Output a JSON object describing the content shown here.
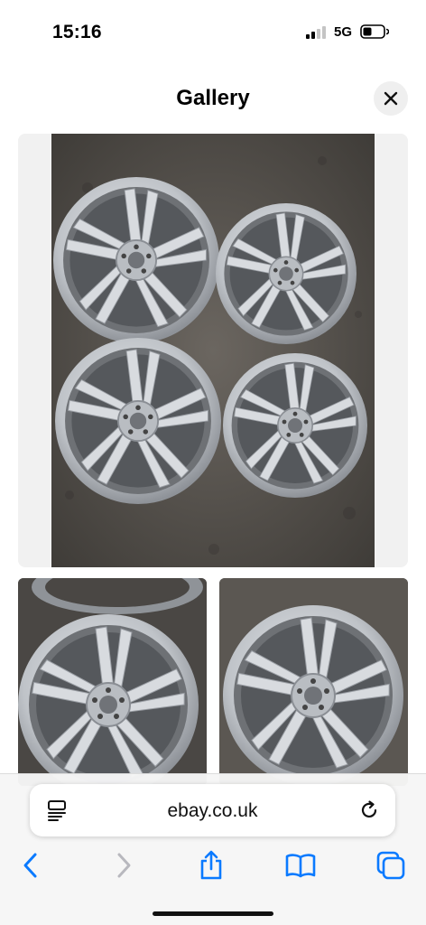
{
  "status_bar": {
    "time": "15:16",
    "network": "5G",
    "signal_bars_active": 2,
    "signal_bars_total": 4
  },
  "header": {
    "title": "Gallery",
    "close_icon": "close-icon"
  },
  "gallery": {
    "images": [
      {
        "kind": "main",
        "subject": "four silver alloy wheels"
      },
      {
        "kind": "thumbnail",
        "subject": "single alloy wheel"
      },
      {
        "kind": "thumbnail",
        "subject": "single alloy wheel"
      }
    ]
  },
  "browser": {
    "url": "ebay.co.uk",
    "icons": {
      "reader": "reader-mode-icon",
      "reload": "reload-icon",
      "back": "back-chevron-icon",
      "forward": "forward-chevron-icon",
      "share": "share-icon",
      "bookmarks": "bookmarks-book-icon",
      "tabs": "tabs-icon"
    }
  },
  "colors": {
    "accent": "#0a7aff",
    "disabled": "#b8b8be",
    "wheel_silver": "#c9ccd1"
  }
}
